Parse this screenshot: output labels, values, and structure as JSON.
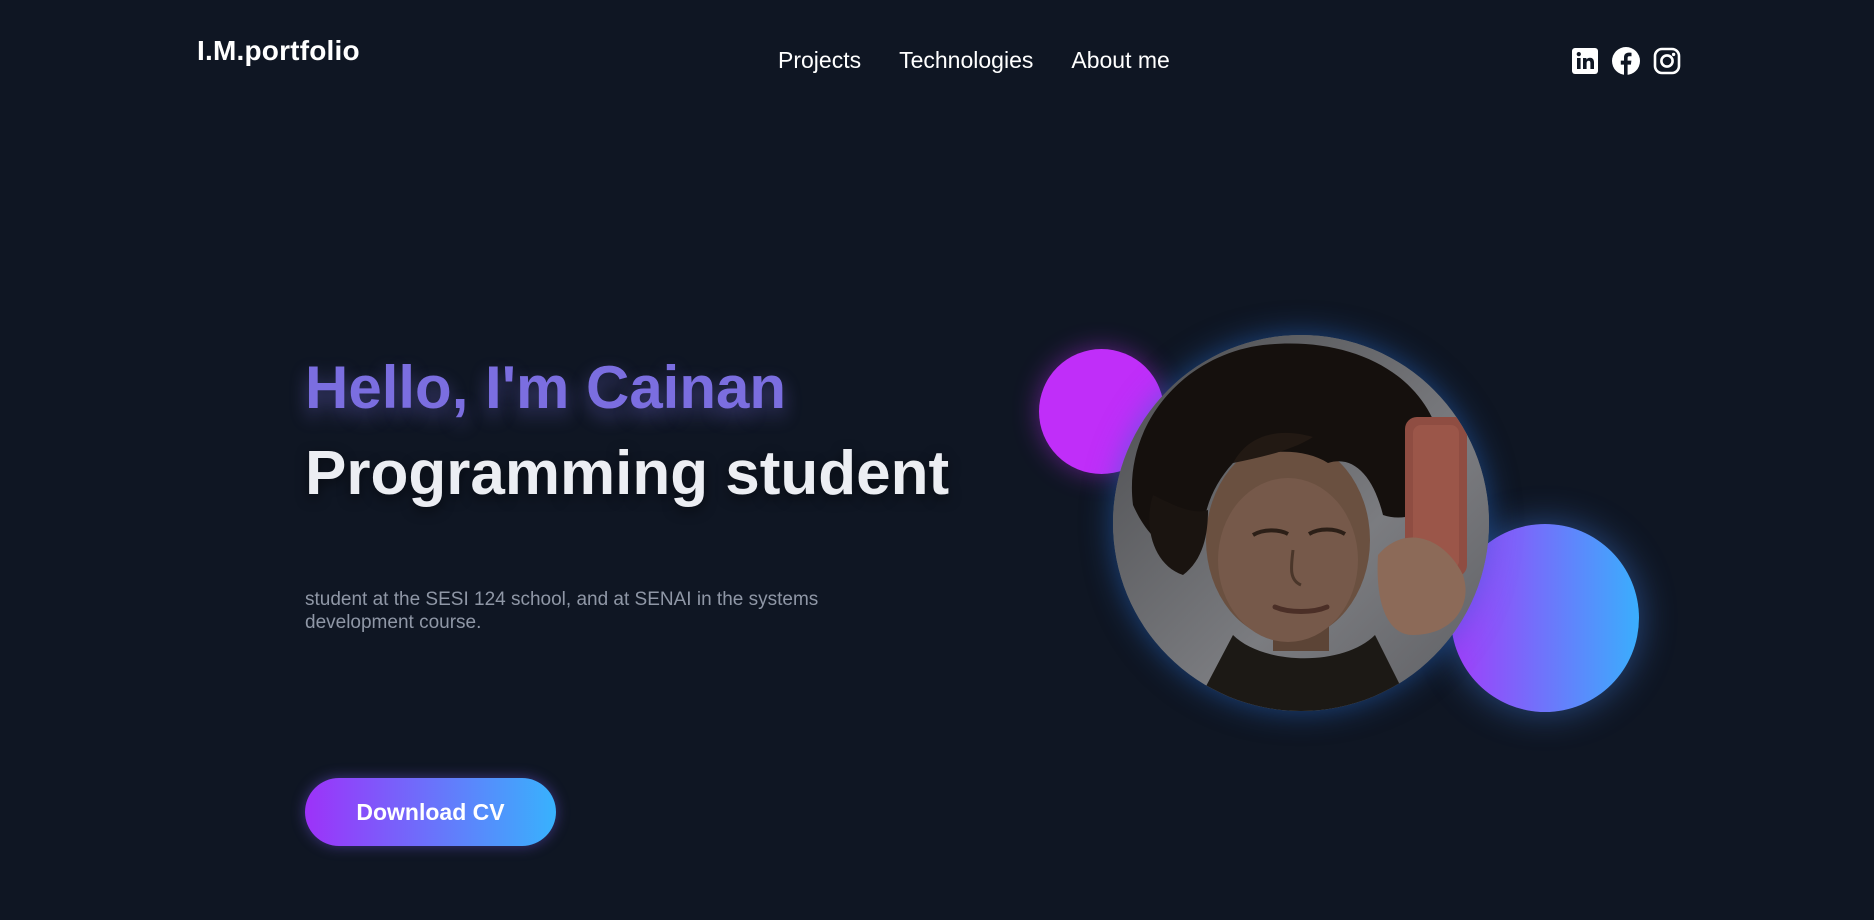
{
  "header": {
    "logo": "I.M.portfolio",
    "nav": [
      {
        "label": "Projects"
      },
      {
        "label": "Technologies"
      },
      {
        "label": "About me"
      }
    ],
    "socials": [
      {
        "icon": "linkedin-icon"
      },
      {
        "icon": "facebook-icon"
      },
      {
        "icon": "instagram-icon"
      }
    ]
  },
  "hero": {
    "greeting": "Hello, I'm Cainan",
    "role": "Programming student",
    "description": "student at the SESI 124 school, and at SENAI in the systems development course.",
    "cta_label": "Download CV"
  },
  "colors": {
    "background": "#0f1623",
    "accent": "#7b6ee0",
    "gradient_start": "#9d32f9",
    "gradient_end": "#38b2fd",
    "blob_purple": "#c02ef9"
  }
}
